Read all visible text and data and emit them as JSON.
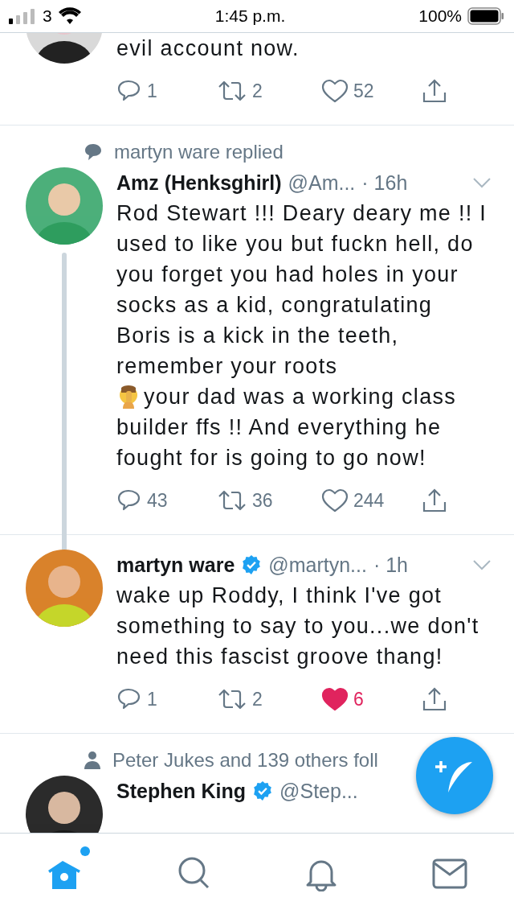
{
  "status_bar": {
    "carrier": "3",
    "time": "1:45 p.m.",
    "battery": "100%"
  },
  "tweets": [
    {
      "partial": true,
      "body": [
        {
          "kind": "text",
          "text": "evil account now."
        }
      ],
      "actions": {
        "replies": "1",
        "retweets": "2",
        "likes": "52",
        "liked": false
      },
      "thread_below": false
    },
    {
      "context": {
        "kind": "reply",
        "text": "martyn ware replied"
      },
      "name": "Amz (Henksghirl)",
      "verified": false,
      "handle": "@Am...",
      "time": "· 16h",
      "body": [
        {
          "kind": "text",
          "text": "Rod Stewart !!! Deary deary me !! I used to like you but fuckn hell, do you forget you had holes in your socks as a kid, congratulating Boris is a kick in the teeth, remember your roots"
        },
        {
          "kind": "emoji",
          "text": "your dad was a working class"
        },
        {
          "kind": "text",
          "text": "builder ffs !! And everything he fought for is going to go now!"
        }
      ],
      "actions": {
        "replies": "43",
        "retweets": "36",
        "likes": "244",
        "liked": false
      },
      "thread_below": true
    },
    {
      "name": "martyn ware",
      "verified": true,
      "handle": "@martyn...",
      "time": "· 1h",
      "body": [
        {
          "kind": "text",
          "text": "wake up Roddy, I think I've got something to say to you...we don't need this fascist groove thang!"
        }
      ],
      "actions": {
        "replies": "1",
        "retweets": "2",
        "likes": "6",
        "liked": true
      },
      "thread_below": false
    },
    {
      "context": {
        "kind": "follow",
        "text": "Peter Jukes and 139 others foll"
      },
      "name": "Stephen King",
      "verified": true,
      "handle": "@Step...",
      "cut": true
    }
  ],
  "tabs": [
    {
      "kind": "home",
      "selected": true,
      "has_new": true
    },
    {
      "kind": "search",
      "selected": false
    },
    {
      "kind": "bell",
      "selected": false
    },
    {
      "kind": "mail",
      "selected": false
    }
  ]
}
